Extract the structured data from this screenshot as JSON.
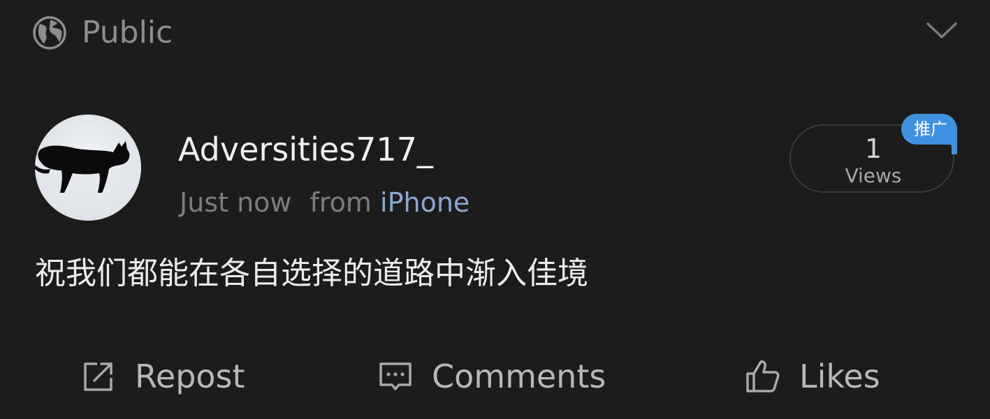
{
  "visibility": {
    "label": "Public",
    "icon": "globe-icon",
    "dropdown_icon": "chevron-down-icon"
  },
  "post": {
    "author": {
      "username": "Adversities717_",
      "avatar": "avatar-black-cat-on-snow"
    },
    "time": "Just now",
    "source_prefix": "from",
    "source_device": "iPhone",
    "views": {
      "count": "1",
      "label": "Views"
    },
    "promo_tag": "推广",
    "text": "祝我们都能在各自选择的道路中渐入佳境"
  },
  "actions": {
    "repost": {
      "label": "Repost",
      "icon": "repost-icon"
    },
    "comments": {
      "label": "Comments",
      "icon": "comment-icon"
    },
    "likes": {
      "label": "Likes",
      "icon": "thumbs-up-icon"
    }
  },
  "colors": {
    "background": "#1c1c1c",
    "primary_text": "#ececec",
    "muted_text": "#7d7d7d",
    "link_blue": "#8aa8d2",
    "promo_blue": "#3f92e0",
    "pill_border": "#3a3a3a"
  }
}
